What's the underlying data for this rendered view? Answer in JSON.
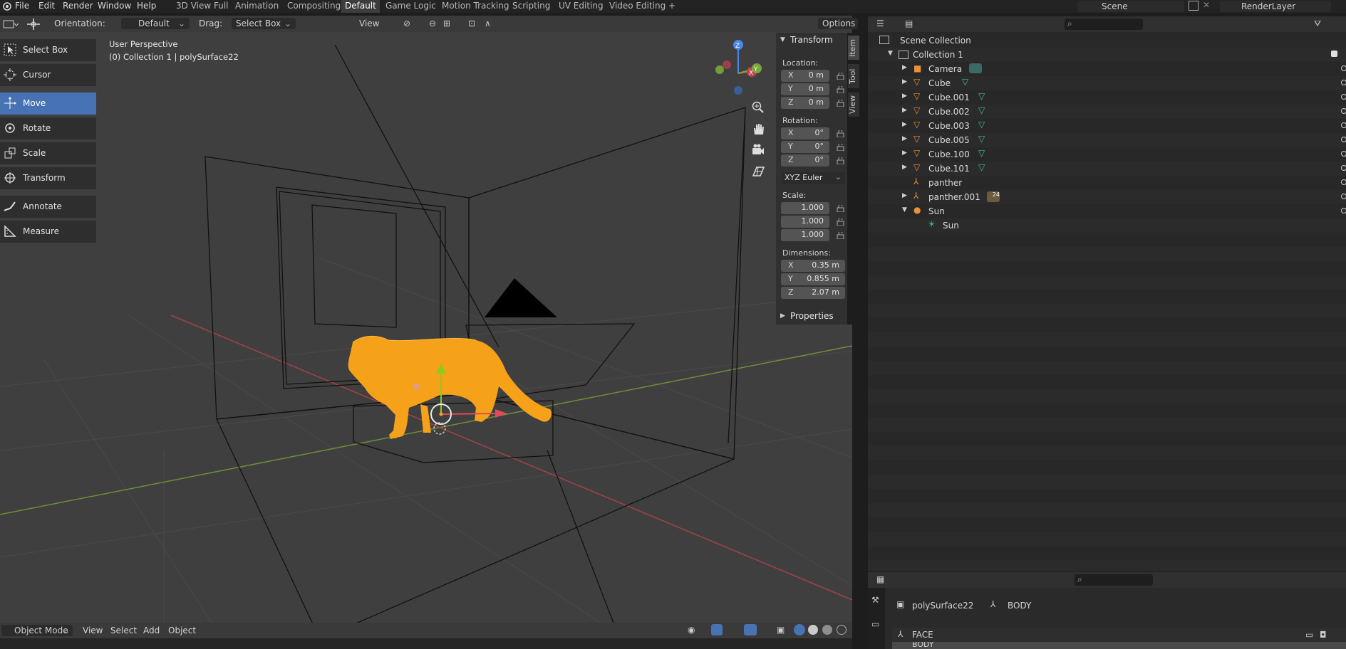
{
  "topbar": {
    "menus": [
      "File",
      "Edit",
      "Render",
      "Window",
      "Help"
    ],
    "workspaces": [
      "3D View Full",
      "Animation",
      "Compositing",
      "Default",
      "Game Logic",
      "Motion Tracking",
      "Scripting",
      "UV Editing",
      "Video Editing"
    ],
    "active_workspace": "Default",
    "add_tab": "+",
    "scene_label": "Scene",
    "render_layer": "RenderLayer"
  },
  "viewport_header": {
    "orientation_label": "Orientation:",
    "orientation_value": "Default",
    "drag_label": "Drag:",
    "drag_value": "Select Box",
    "view_menu": "View",
    "options": "Options"
  },
  "viewport": {
    "perspective_label": "User Perspective",
    "context_label": "(0) Collection 1 | polySurface22",
    "gizmo": {
      "x": "X",
      "y": "Y",
      "z": "Z"
    }
  },
  "toolbar": {
    "items": [
      {
        "label": "Select Box",
        "icon": "select-box-icon"
      },
      {
        "label": "Cursor",
        "icon": "cursor-icon"
      },
      {
        "label": "Move",
        "icon": "move-icon",
        "active": true
      },
      {
        "label": "Rotate",
        "icon": "rotate-icon"
      },
      {
        "label": "Scale",
        "icon": "scale-icon"
      },
      {
        "label": "Transform",
        "icon": "transform-icon"
      },
      {
        "label": "Annotate",
        "icon": "annotate-icon"
      },
      {
        "label": "Measure",
        "icon": "measure-icon"
      }
    ]
  },
  "npanel": {
    "title": "Transform",
    "location_label": "Location:",
    "location": [
      {
        "axis": "X",
        "value": "0 m"
      },
      {
        "axis": "Y",
        "value": "0 m"
      },
      {
        "axis": "Z",
        "value": "0 m"
      }
    ],
    "rotation_label": "Rotation:",
    "rotation": [
      {
        "axis": "X",
        "value": "0°"
      },
      {
        "axis": "Y",
        "value": "0°"
      },
      {
        "axis": "Z",
        "value": "0°"
      }
    ],
    "rotation_mode": "XYZ Euler",
    "scale_label": "Scale:",
    "scale": [
      "1.000",
      "1.000",
      "1.000"
    ],
    "dimensions_label": "Dimensions:",
    "dimensions": [
      {
        "axis": "X",
        "value": "0.35 m"
      },
      {
        "axis": "Y",
        "value": "0.855 m"
      },
      {
        "axis": "Z",
        "value": "2.07 m"
      }
    ],
    "properties_label": "Properties",
    "tabs": [
      "Item",
      "Tool",
      "View"
    ]
  },
  "outliner": {
    "root": "Scene Collection",
    "collection": "Collection 1",
    "items": [
      {
        "name": "Camera",
        "type": "camera"
      },
      {
        "name": "Cube",
        "type": "mesh"
      },
      {
        "name": "Cube.001",
        "type": "mesh"
      },
      {
        "name": "Cube.002",
        "type": "mesh"
      },
      {
        "name": "Cube.003",
        "type": "mesh"
      },
      {
        "name": "Cube.005",
        "type": "mesh"
      },
      {
        "name": "Cube.100",
        "type": "mesh"
      },
      {
        "name": "Cube.101",
        "type": "mesh"
      },
      {
        "name": "panther",
        "type": "armature"
      },
      {
        "name": "panther.001",
        "type": "armature",
        "badge": "24"
      },
      {
        "name": "Sun",
        "type": "light"
      }
    ],
    "sun_child": "Sun"
  },
  "bottom_header": {
    "mode": "Object Mode",
    "menus": [
      "View",
      "Select",
      "Add",
      "Object"
    ]
  },
  "properties": {
    "object": "polySurface22",
    "armature": "BODY",
    "bones": [
      "FACE",
      "BODY"
    ]
  },
  "colors": {
    "accent": "#4772b3",
    "panther": "#f5a21a",
    "selected_outline": "#f5a21a",
    "x_axis": "#c0424f",
    "y_axis": "#7aa63a",
    "z_axis": "#4a86e8"
  }
}
